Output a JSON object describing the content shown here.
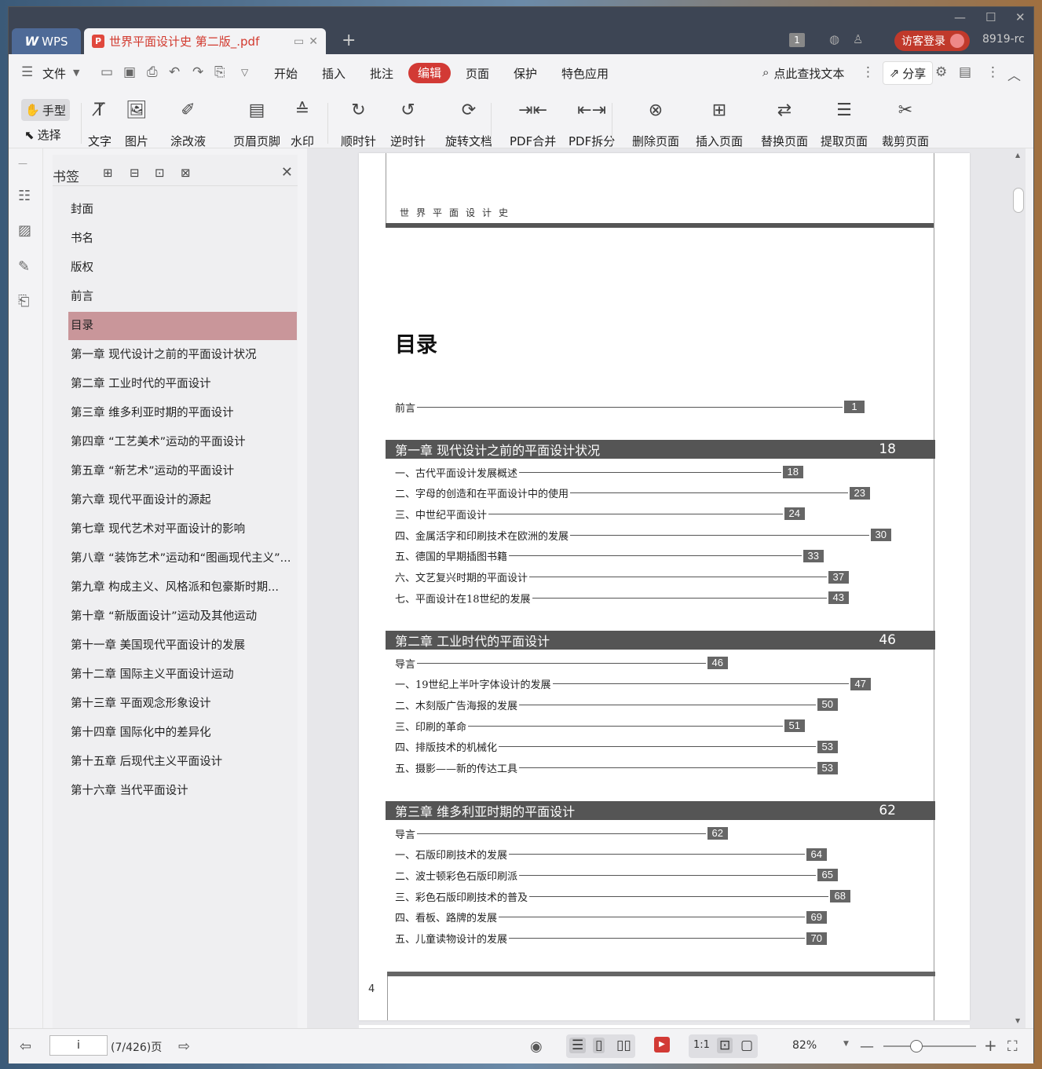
{
  "titlebar": {
    "app_tab": "WPS",
    "doc_tab": "世界平面设计史 第二版_.pdf",
    "badge_count": "1",
    "login_label": "访客登录",
    "user_id": "8919-rc"
  },
  "menubar": {
    "file": "文件",
    "tabs": [
      "开始",
      "插入",
      "批注",
      "编辑",
      "页面",
      "保护",
      "特色应用"
    ],
    "active_tab": "编辑",
    "search_label": "点此查找文本",
    "share_label": "分享"
  },
  "toolbar": {
    "hand": "手型",
    "select": "选择",
    "tools": [
      {
        "label": "文字",
        "icon": "text-edit-icon"
      },
      {
        "label": "图片",
        "icon": "image-edit-icon"
      },
      {
        "label": "涂改液",
        "icon": "correction-fluid-icon"
      },
      {
        "label": "页眉页脚",
        "icon": "header-footer-icon"
      },
      {
        "label": "水印",
        "icon": "watermark-icon"
      },
      {
        "label": "顺时针",
        "icon": "rotate-cw-icon"
      },
      {
        "label": "逆时针",
        "icon": "rotate-ccw-icon"
      },
      {
        "label": "旋转文档",
        "icon": "rotate-doc-icon"
      },
      {
        "label": "PDF合并",
        "icon": "pdf-merge-icon"
      },
      {
        "label": "PDF拆分",
        "icon": "pdf-split-icon"
      },
      {
        "label": "删除页面",
        "icon": "delete-page-icon"
      },
      {
        "label": "插入页面",
        "icon": "insert-page-icon"
      },
      {
        "label": "替换页面",
        "icon": "replace-page-icon"
      },
      {
        "label": "提取页面",
        "icon": "extract-page-icon"
      },
      {
        "label": "裁剪页面",
        "icon": "crop-page-icon"
      }
    ]
  },
  "bookmarks": {
    "title": "书签",
    "items": [
      {
        "label": "封面",
        "expandable": false
      },
      {
        "label": "书名",
        "expandable": false
      },
      {
        "label": "版权",
        "expandable": false
      },
      {
        "label": "前言",
        "expandable": false
      },
      {
        "label": "目录",
        "expandable": false,
        "selected": true
      },
      {
        "label": "第一章  现代设计之前的平面设计状况",
        "expandable": true
      },
      {
        "label": "第二章  工业时代的平面设计",
        "expandable": true
      },
      {
        "label": "第三章  维多利亚时期的平面设计",
        "expandable": true
      },
      {
        "label": "第四章  “工艺美术”运动的平面设计",
        "expandable": true
      },
      {
        "label": "第五章  “新艺术”运动的平面设计",
        "expandable": true
      },
      {
        "label": "第六章  现代平面设计的源起",
        "expandable": true
      },
      {
        "label": "第七章  现代艺术对平面设计的影响",
        "expandable": true
      },
      {
        "label": "第八章  “装饰艺术”运动和“图画现代主义”...",
        "expandable": true
      },
      {
        "label": "第九章  构成主义、风格派和包豪斯时期...",
        "expandable": true
      },
      {
        "label": "第十章  “新版面设计”运动及其他运动",
        "expandable": true
      },
      {
        "label": "第十一章  美国现代平面设计的发展",
        "expandable": true
      },
      {
        "label": "第十二章  国际主义平面设计运动",
        "expandable": true
      },
      {
        "label": "第十三章  平面观念形象设计",
        "expandable": true
      },
      {
        "label": "第十四章  国际化中的差异化",
        "expandable": true
      },
      {
        "label": "第十五章  后现代主义平面设计",
        "expandable": true
      },
      {
        "label": "第十六章  当代平面设计",
        "expandable": true
      }
    ]
  },
  "document": {
    "running_head": "世界平面设计史",
    "toc_title": "目录",
    "page_number": "4",
    "preface": {
      "label": "前言",
      "page": "1"
    },
    "chapters": [
      {
        "title": "第一章   现代设计之前的平面设计状况",
        "page": "18",
        "entries": [
          {
            "label": "一、古代平面设计发展概述",
            "page": "18"
          },
          {
            "label": "二、字母的创造和在平面设计中的使用",
            "page": "23"
          },
          {
            "label": "三、中世纪平面设计",
            "page": "24"
          },
          {
            "label": "四、金属活字和印刷技术在欧洲的发展",
            "page": "30"
          },
          {
            "label": "五、德国的早期插图书籍",
            "page": "33"
          },
          {
            "label": "六、文艺复兴时期的平面设计",
            "page": "37"
          },
          {
            "label": "七、平面设计在18世纪的发展",
            "page": "43"
          }
        ]
      },
      {
        "title": "第二章   工业时代的平面设计",
        "page": "46",
        "entries": [
          {
            "label": "导言",
            "page": "46"
          },
          {
            "label": "一、19世纪上半叶字体设计的发展",
            "page": "47"
          },
          {
            "label": "二、木刻版广告海报的发展",
            "page": "50"
          },
          {
            "label": "三、印刷的革命",
            "page": "51"
          },
          {
            "label": "四、排版技术的机械化",
            "page": "53"
          },
          {
            "label": "五、摄影——新的传达工具",
            "page": "53"
          }
        ]
      },
      {
        "title": "第三章   维多利亚时期的平面设计",
        "page": "62",
        "entries": [
          {
            "label": "导言",
            "page": "62"
          },
          {
            "label": "一、石版印刷技术的发展",
            "page": "64"
          },
          {
            "label": "二、波士顿彩色石版印刷派",
            "page": "65"
          },
          {
            "label": "三、彩色石版印刷技术的普及",
            "page": "68"
          },
          {
            "label": "四、看板、路牌的发展",
            "page": "69"
          },
          {
            "label": "五、儿童读物设计的发展",
            "page": "70"
          }
        ]
      }
    ]
  },
  "statusbar": {
    "page_input": "i",
    "page_total": "(7/426)页",
    "zoom": "82%",
    "zoom_level": 0.36
  },
  "colors": {
    "accent": "#d23a35",
    "selected_bookmark": "#c9969a",
    "titlebar": "#3d4554"
  }
}
